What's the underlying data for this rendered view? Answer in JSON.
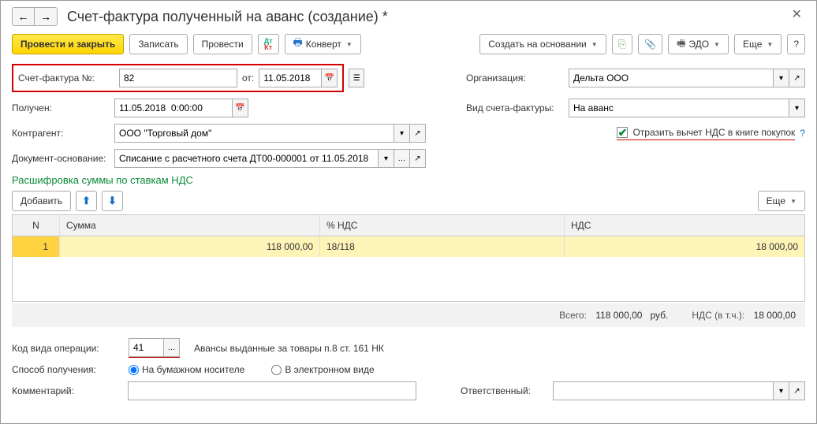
{
  "title": "Счет-фактура полученный на аванс (создание) *",
  "toolbar": {
    "post_close": "Провести и закрыть",
    "write": "Записать",
    "post": "Провести",
    "convert": "Конверт",
    "create_based": "Создать на основании",
    "edo": "ЭДО",
    "more": "Еще"
  },
  "form": {
    "number_label": "Счет-фактура №:",
    "number_value": "82",
    "from_label": "от:",
    "from_date": "11.05.2018",
    "received_label": "Получен:",
    "received_value": "11.05.2018  0:00:00",
    "counterparty_label": "Контрагент:",
    "counterparty_value": "ООО \"Торговый дом\"",
    "basis_label": "Документ-основание:",
    "basis_value": "Списание с расчетного счета ДТ00-000001 от 11.05.2018",
    "org_label": "Организация:",
    "org_value": "Дельта ООО",
    "kind_label": "Вид счета-фактуры:",
    "kind_value": "На аванс",
    "vat_check": "Отразить вычет НДС в книге покупок"
  },
  "section_title": "Расшифровка суммы по ставкам НДС",
  "table_toolbar": {
    "add": "Добавить",
    "more": "Еще"
  },
  "grid": {
    "headers": {
      "n": "N",
      "sum": "Сумма",
      "pct": "% НДС",
      "vat": "НДС"
    },
    "rows": [
      {
        "n": "1",
        "sum": "118 000,00",
        "pct": "18/118",
        "vat": "18 000,00"
      }
    ]
  },
  "totals": {
    "total_label": "Всего:",
    "total_value": "118 000,00",
    "currency": "руб.",
    "vat_label": "НДС (в т.ч.):",
    "vat_value": "18 000,00"
  },
  "footer": {
    "op_code_label": "Код вида операции:",
    "op_code_value": "41",
    "op_code_desc": "Авансы выданные за товары п.8 ст. 161 НК",
    "receive_label": "Способ получения:",
    "radio_paper": "На бумажном носителе",
    "radio_electronic": "В электронном виде",
    "comment_label": "Комментарий:",
    "responsible_label": "Ответственный:"
  }
}
